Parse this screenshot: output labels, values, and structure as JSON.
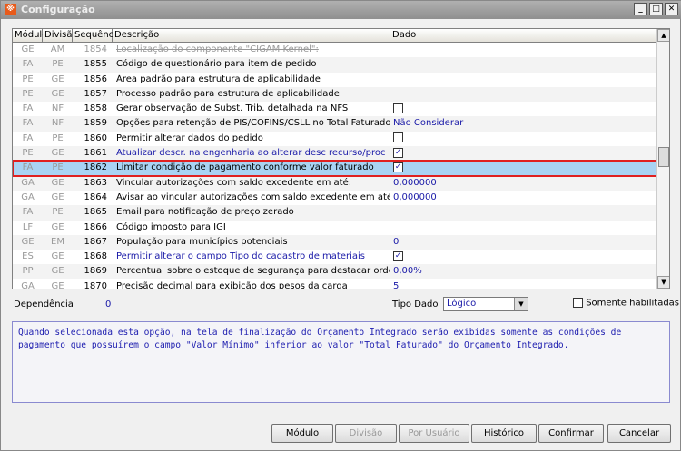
{
  "window": {
    "title": "Configuração"
  },
  "grid": {
    "columns": [
      "Módulo",
      "Divisão",
      "Sequência",
      "Descrição",
      "Dado"
    ],
    "rows": [
      {
        "modulo": "GE",
        "divisao": "AM",
        "seq": "1854",
        "desc": "Localização do componente \"CIGAM Kernel\":",
        "dado": "",
        "style": "strike"
      },
      {
        "modulo": "FA",
        "divisao": "PE",
        "seq": "1855",
        "desc": "Código de questionário para item de pedido",
        "dado": ""
      },
      {
        "modulo": "PE",
        "divisao": "GE",
        "seq": "1856",
        "desc": "Área padrão para estrutura de aplicabilidade",
        "dado": ""
      },
      {
        "modulo": "PE",
        "divisao": "GE",
        "seq": "1857",
        "desc": "Processo padrão para estrutura de aplicabilidade",
        "dado": ""
      },
      {
        "modulo": "FA",
        "divisao": "NF",
        "seq": "1858",
        "desc": "Gerar observação de Subst. Trib. detalhada na NFS",
        "checkbox": false
      },
      {
        "modulo": "FA",
        "divisao": "NF",
        "seq": "1859",
        "desc": "Opções para retenção de PIS/COFINS/CSLL no Total Faturado",
        "dado": "Não Considerar"
      },
      {
        "modulo": "FA",
        "divisao": "PE",
        "seq": "1860",
        "desc": "Permitir alterar dados do pedido",
        "checkbox": false
      },
      {
        "modulo": "PE",
        "divisao": "GE",
        "seq": "1861",
        "desc": "Atualizar descr. na engenharia ao alterar desc recurso/proc",
        "checkbox": true,
        "style": "blue"
      },
      {
        "modulo": "FA",
        "divisao": "PE",
        "seq": "1862",
        "desc": "Limitar condição de pagamento conforme valor faturado",
        "checkbox": true,
        "style": "sel"
      },
      {
        "modulo": "GA",
        "divisao": "GE",
        "seq": "1863",
        "desc": "Vincular autorizações com saldo excedente em até:",
        "dado": "0,000000"
      },
      {
        "modulo": "GA",
        "divisao": "GE",
        "seq": "1864",
        "desc": "Avisar ao vincular autorizações com saldo excedente em até:",
        "dado": "0,000000"
      },
      {
        "modulo": "FA",
        "divisao": "PE",
        "seq": "1865",
        "desc": "Email para notificação de preço zerado",
        "dado": ""
      },
      {
        "modulo": "LF",
        "divisao": "GE",
        "seq": "1866",
        "desc": "Código imposto para IGI",
        "dado": ""
      },
      {
        "modulo": "GE",
        "divisao": "EM",
        "seq": "1867",
        "desc": "População para municípios potenciais",
        "dado": "0"
      },
      {
        "modulo": "ES",
        "divisao": "GE",
        "seq": "1868",
        "desc": "Permitir alterar o campo Tipo do cadastro de materiais",
        "checkbox": true,
        "style": "blue"
      },
      {
        "modulo": "PP",
        "divisao": "GE",
        "seq": "1869",
        "desc": "Percentual sobre o estoque de segurança para destacar ordens",
        "dado": "0,00%"
      },
      {
        "modulo": "GA",
        "divisao": "GE",
        "seq": "1870",
        "desc": "Precisão decimal para exibição dos pesos da carga",
        "dado": "5"
      }
    ]
  },
  "footer": {
    "dependencia_label": "Dependência",
    "dependencia_value": "0",
    "tipo_dado_label": "Tipo Dado",
    "tipo_dado_value": "Lógico",
    "somente_label": "Somente habilitadas"
  },
  "description": "Quando selecionada esta opção, na tela de finalização do Orçamento Integrado serão exibidas somente as condições de pagamento que possuírem o campo \"Valor Mínimo\" inferior ao valor \"Total Faturado\" do Orçamento Integrado.",
  "buttons": {
    "modulo": "Módulo",
    "divisao": "Divisão",
    "por_usuario": "Por Usuário",
    "historico": "Histórico",
    "confirmar": "Confirmar",
    "cancelar": "Cancelar"
  }
}
